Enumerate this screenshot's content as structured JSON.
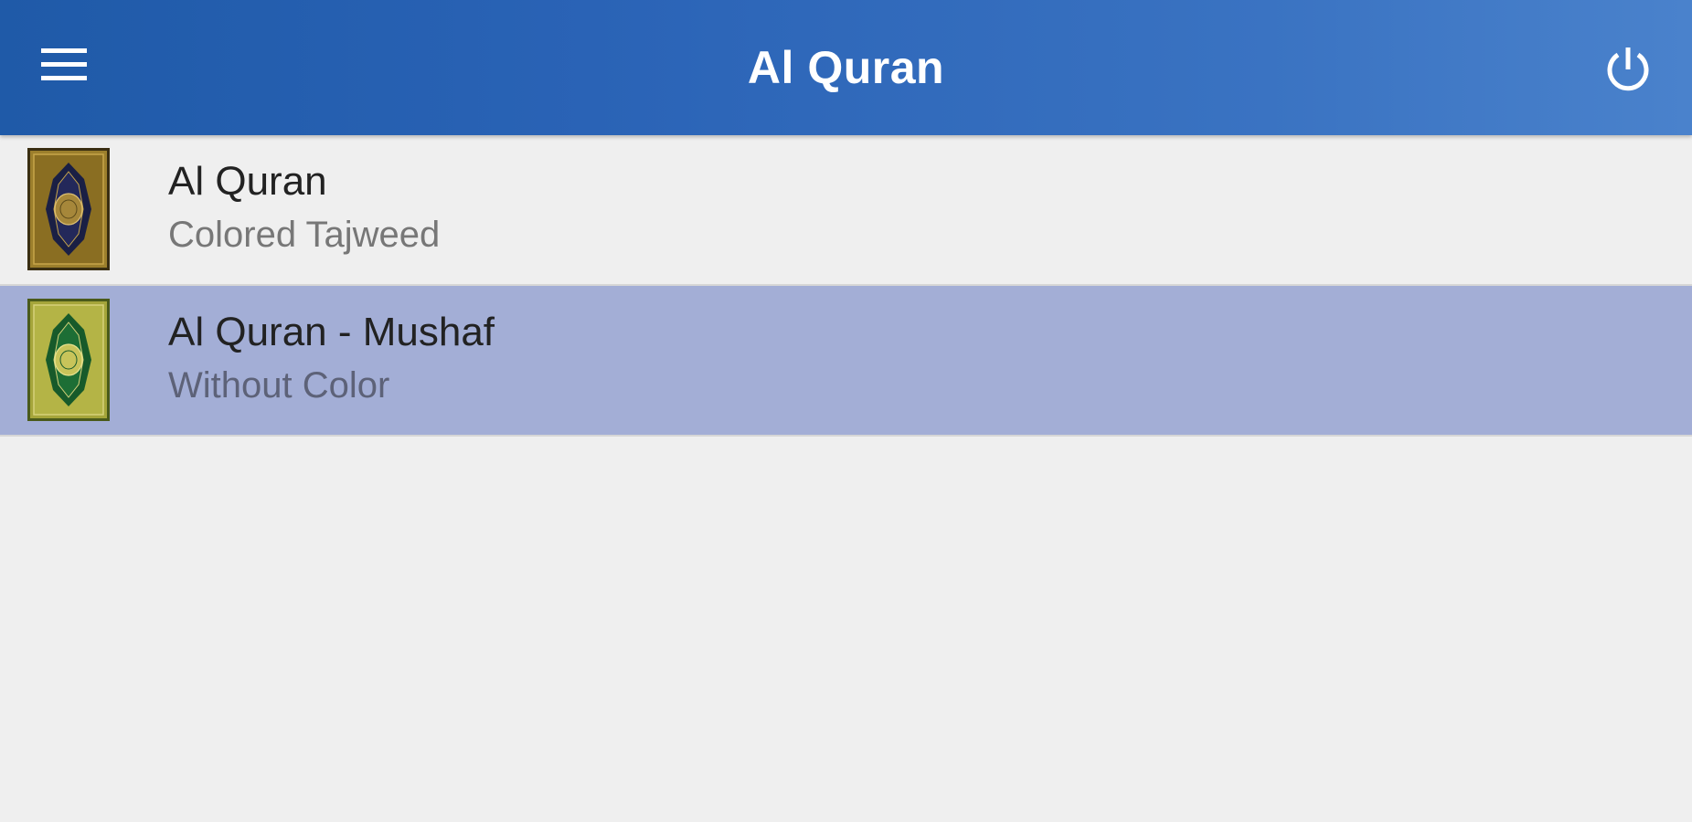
{
  "app_bar": {
    "title": "Al Quran",
    "menu_icon": "hamburger-menu-icon",
    "power_icon": "power-icon",
    "gradient_start": "#1f5aa8",
    "gradient_end": "#4a82cc"
  },
  "list": {
    "items": [
      {
        "title": "Al Quran",
        "subtitle": "Colored Tajweed",
        "icon": "quran-cover-navy-gold-icon",
        "selected": false
      },
      {
        "title": "Al Quran - Mushaf",
        "subtitle": "Without Color",
        "icon": "quran-cover-green-gold-icon",
        "selected": true
      }
    ],
    "selected_color": "#a3aed6"
  }
}
